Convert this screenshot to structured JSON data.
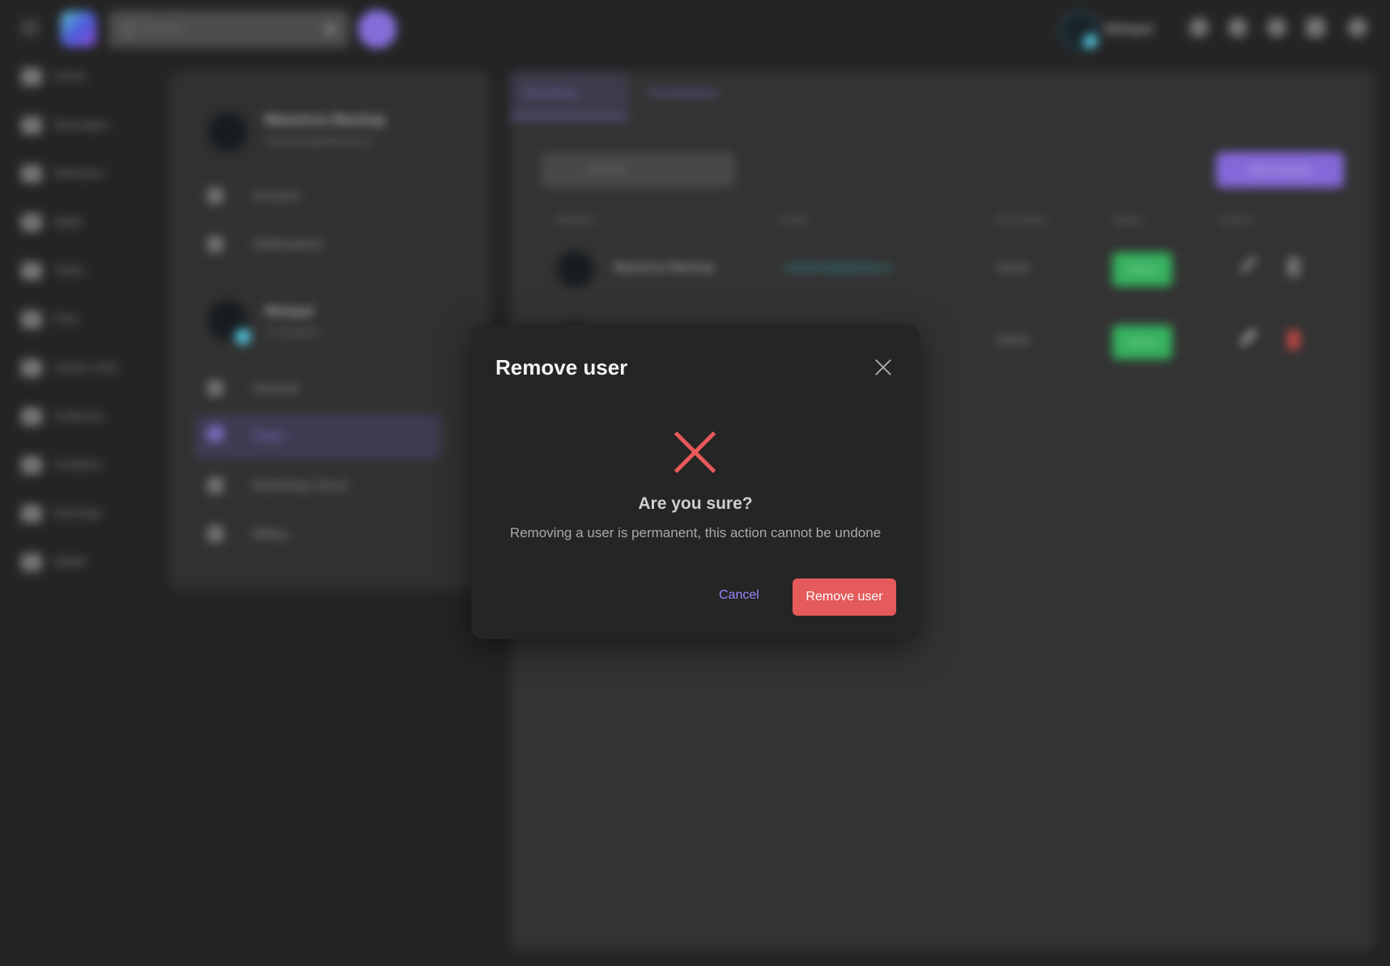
{
  "topbar": {
    "search_placeholder": "Search",
    "user_name": "Webpal"
  },
  "nav": {
    "items": [
      {
        "label": "Home",
        "icon": "home-icon"
      },
      {
        "label": "Messages",
        "icon": "messages-icon"
      },
      {
        "label": "Releases",
        "icon": "releases-icon"
      },
      {
        "label": "Splits",
        "icon": "splits-icon"
      },
      {
        "label": "Tasks",
        "icon": "tasks-icon"
      },
      {
        "label": "Files",
        "icon": "files-icon"
      },
      {
        "label": "Smart Links",
        "icon": "smart-links-icon"
      },
      {
        "label": "Audience",
        "icon": "audience-icon"
      },
      {
        "label": "Analytics",
        "icon": "analytics-icon"
      },
      {
        "label": "Earnings",
        "icon": "earnings-icon"
      },
      {
        "label": "Wallet",
        "icon": "wallet-icon"
      }
    ]
  },
  "settings": {
    "account_name": "Maestroe Backup",
    "account_email": "maestroe@abeaea.io",
    "account_items": [
      "Account",
      "Notifications"
    ],
    "workspace_name": "Webpal",
    "workspace_sub": "2 members",
    "workspace_items": [
      "General",
      "Team",
      "Marketing Cloud",
      "Billing"
    ]
  },
  "main": {
    "tabs": [
      "Members",
      "Permissions"
    ],
    "search_placeholder": "Search",
    "add_button": "Add member",
    "columns": [
      "Member",
      "Email",
      "Permission",
      "Status",
      "Actions"
    ],
    "rows": [
      {
        "name": "Maestroe Backup",
        "email": "maestroe@abeaea.io",
        "permission": "Owner",
        "status": "Active"
      },
      {
        "name": "",
        "email": "",
        "permission": "Admin",
        "status": "Active"
      }
    ]
  },
  "dialog": {
    "title": "Remove user",
    "question": "Are you sure?",
    "message": "Removing a user is permanent, this action cannot be undone",
    "cancel_label": "Cancel",
    "confirm_label": "Remove user"
  },
  "colors": {
    "accent": "#9c86ff",
    "danger": "#e55a5a",
    "dialog_bg": "#252525"
  }
}
